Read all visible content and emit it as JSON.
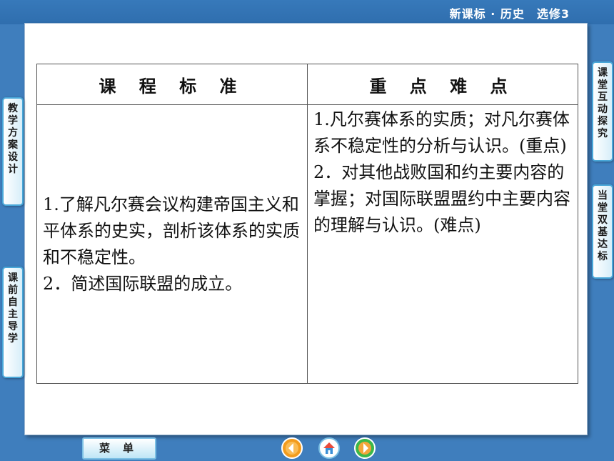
{
  "header": {
    "course_title": "新课标 · 历史　选修3"
  },
  "table": {
    "headers": [
      "课 程 标 准",
      "重 点 难 点"
    ],
    "left_items": [
      "1.了解凡尔赛会议构建帝国主义和平体系的史实，剖析该体系的实质和不稳定性。",
      "2．简述国际联盟的成立。"
    ],
    "right_items": [
      "1.凡尔赛体系的实质；对凡尔赛体系不稳定性的分析与认识。(重点)",
      "2．对其他战败国和约主要内容的掌握；对国际联盟盟约中主要内容的理解与认识。(难点)"
    ]
  },
  "side_tabs": {
    "left_top": "教学方案设计",
    "left_bottom": "课前自主导学",
    "right_top": "课堂互动探究",
    "right_bottom": "当堂双基达标"
  },
  "bottom": {
    "menu_label": "菜单"
  },
  "icons": {
    "prev": "arrow-left-icon",
    "home": "home-icon",
    "next": "arrow-right-icon"
  },
  "colors": {
    "background": "#3f7ebd",
    "tab_border": "#49a7d8",
    "nav_orange": "#f39c1e",
    "nav_green": "#3bb84a"
  }
}
